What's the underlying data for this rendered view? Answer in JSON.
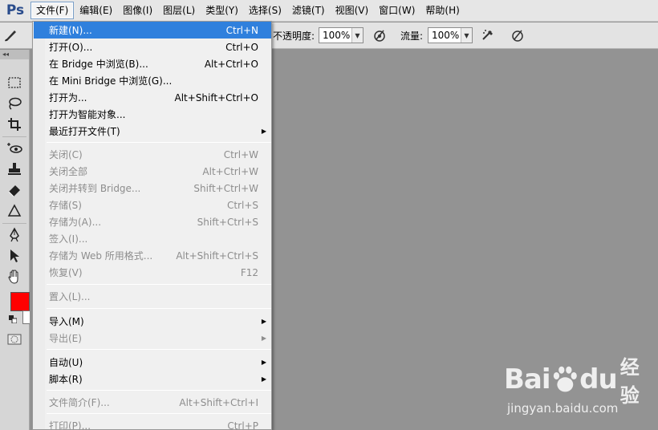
{
  "app": {
    "logo": "Ps"
  },
  "menubar": {
    "items": [
      {
        "label": "文件(F)",
        "active": true
      },
      {
        "label": "编辑(E)"
      },
      {
        "label": "图像(I)"
      },
      {
        "label": "图层(L)"
      },
      {
        "label": "类型(Y)"
      },
      {
        "label": "选择(S)"
      },
      {
        "label": "滤镜(T)"
      },
      {
        "label": "视图(V)"
      },
      {
        "label": "窗口(W)"
      },
      {
        "label": "帮助(H)"
      }
    ]
  },
  "options": {
    "opacity_label": "不透明度:",
    "opacity_value": "100%",
    "flow_label": "流量:",
    "flow_value": "100%"
  },
  "file_menu": {
    "items": [
      {
        "label": "新建(N)...",
        "shortcut": "Ctrl+N",
        "highlighted": true
      },
      {
        "label": "打开(O)...",
        "shortcut": "Ctrl+O"
      },
      {
        "label": "在 Bridge 中浏览(B)...",
        "shortcut": "Alt+Ctrl+O"
      },
      {
        "label": "在 Mini Bridge 中浏览(G)...",
        "shortcut": ""
      },
      {
        "label": "打开为...",
        "shortcut": "Alt+Shift+Ctrl+O"
      },
      {
        "label": "打开为智能对象...",
        "shortcut": ""
      },
      {
        "label": "最近打开文件(T)",
        "shortcut": "",
        "submenu": true
      },
      {
        "label": "关闭(C)",
        "shortcut": "Ctrl+W",
        "disabled": true
      },
      {
        "label": "关闭全部",
        "shortcut": "Alt+Ctrl+W",
        "disabled": true
      },
      {
        "label": "关闭并转到 Bridge...",
        "shortcut": "Shift+Ctrl+W",
        "disabled": true
      },
      {
        "label": "存储(S)",
        "shortcut": "Ctrl+S",
        "disabled": true
      },
      {
        "label": "存储为(A)...",
        "shortcut": "Shift+Ctrl+S",
        "disabled": true
      },
      {
        "label": "签入(I)...",
        "shortcut": "",
        "disabled": true
      },
      {
        "label": "存储为 Web 所用格式...",
        "shortcut": "Alt+Shift+Ctrl+S",
        "disabled": true
      },
      {
        "label": "恢复(V)",
        "shortcut": "F12",
        "disabled": true
      },
      {
        "label": "置入(L)...",
        "shortcut": "",
        "disabled": true
      },
      {
        "label": "导入(M)",
        "shortcut": "",
        "submenu": true
      },
      {
        "label": "导出(E)",
        "shortcut": "",
        "submenu": true,
        "disabled": true
      },
      {
        "label": "自动(U)",
        "shortcut": "",
        "submenu": true
      },
      {
        "label": "脚本(R)",
        "shortcut": "",
        "submenu": true
      },
      {
        "label": "文件简介(F)...",
        "shortcut": "Alt+Shift+Ctrl+I",
        "disabled": true
      },
      {
        "label": "打印(P)...",
        "shortcut": "Ctrl+P",
        "disabled": true
      }
    ]
  },
  "colors": {
    "foreground": "#ff0000",
    "background": "#ffffff",
    "highlight": "#2f80dd"
  },
  "watermark": {
    "brand": "Bai",
    "brand2": "du",
    "product": "经验",
    "url": "jingyan.baidu.com"
  }
}
